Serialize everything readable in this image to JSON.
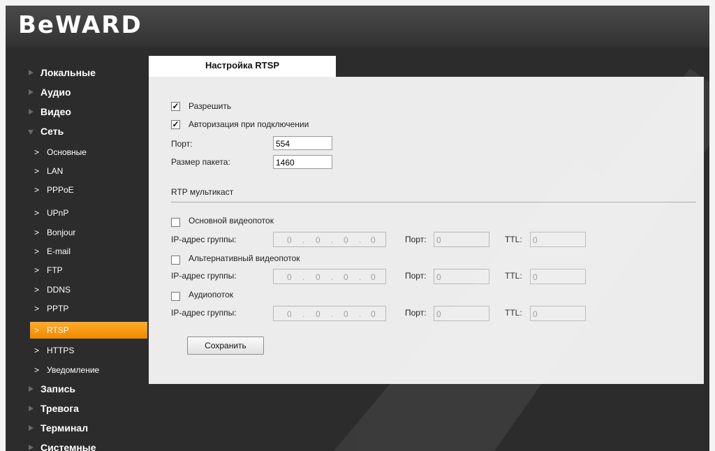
{
  "brand": {
    "logo_text": "BeWARD"
  },
  "sidebar": {
    "items": [
      {
        "label": "Локальные",
        "expanded": false
      },
      {
        "label": "Аудио",
        "expanded": false
      },
      {
        "label": "Видео",
        "expanded": false
      },
      {
        "label": "Сеть",
        "expanded": true,
        "children": [
          {
            "label": "Основные"
          },
          {
            "label": "LAN"
          },
          {
            "label": "PPPoE"
          },
          {
            "label": "UPnP"
          },
          {
            "label": "Bonjour"
          },
          {
            "label": "E-mail"
          },
          {
            "label": "FTP"
          },
          {
            "label": "DDNS"
          },
          {
            "label": "PPTP"
          },
          {
            "label": "RTSP",
            "active": true
          },
          {
            "label": "HTTPS"
          },
          {
            "label": "Уведомление"
          }
        ]
      },
      {
        "label": "Запись",
        "expanded": false
      },
      {
        "label": "Тревога",
        "expanded": false
      },
      {
        "label": "Терминал",
        "expanded": false
      },
      {
        "label": "Системные",
        "expanded": false
      }
    ],
    "chevron": ">",
    "active_color": "#f59a12"
  },
  "tab": {
    "title": "Настройка RTSP"
  },
  "form": {
    "enable": {
      "label": "Разрешить",
      "checked": true
    },
    "auth": {
      "label": "Авторизация при подключении",
      "checked": true
    },
    "port": {
      "label": "Порт:",
      "value": "554"
    },
    "packet_size": {
      "label": "Размер пакета:",
      "value": "1460"
    },
    "multicast": {
      "heading": "RTP мультикаст",
      "streams": [
        {
          "label": "Основной видеопоток",
          "checked": false,
          "ip_label": "IP-адрес группы:",
          "ip": [
            "0",
            "0",
            "0",
            "0"
          ],
          "port_label": "Порт:",
          "port": "0",
          "ttl_label": "TTL:",
          "ttl": "0"
        },
        {
          "label": "Альтернативный видеопоток",
          "checked": false,
          "ip_label": "IP-адрес группы:",
          "ip": [
            "0",
            "0",
            "0",
            "0"
          ],
          "port_label": "Порт:",
          "port": "0",
          "ttl_label": "TTL:",
          "ttl": "0"
        },
        {
          "label": "Аудиопоток",
          "checked": false,
          "ip_label": "IP-адрес группы:",
          "ip": [
            "0",
            "0",
            "0",
            "0"
          ],
          "port_label": "Порт:",
          "port": "0",
          "ttl_label": "TTL:",
          "ttl": "0"
        }
      ]
    },
    "ip_separator": ".",
    "check_mark": "✓",
    "save_label": "Сохранить"
  }
}
